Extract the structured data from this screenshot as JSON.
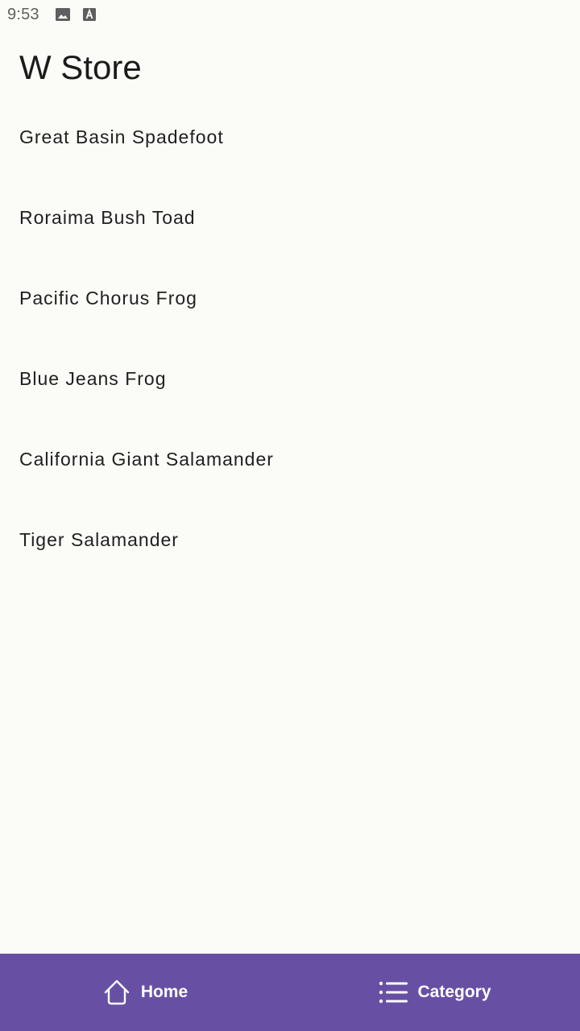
{
  "status_bar": {
    "time": "9:53",
    "icons": [
      "image-icon",
      "font-download-icon"
    ]
  },
  "app": {
    "title": "W Store"
  },
  "list": {
    "items": [
      {
        "label": "Great Basin Spadefoot"
      },
      {
        "label": "Roraima Bush Toad"
      },
      {
        "label": "Pacific Chorus Frog"
      },
      {
        "label": "Blue Jeans Frog"
      },
      {
        "label": "California Giant Salamander"
      },
      {
        "label": "Tiger Salamander"
      }
    ]
  },
  "bottom_nav": {
    "background_color": "#6750a4",
    "items": [
      {
        "label": "Home",
        "icon": "home-icon"
      },
      {
        "label": "Category",
        "icon": "list-icon"
      }
    ]
  }
}
